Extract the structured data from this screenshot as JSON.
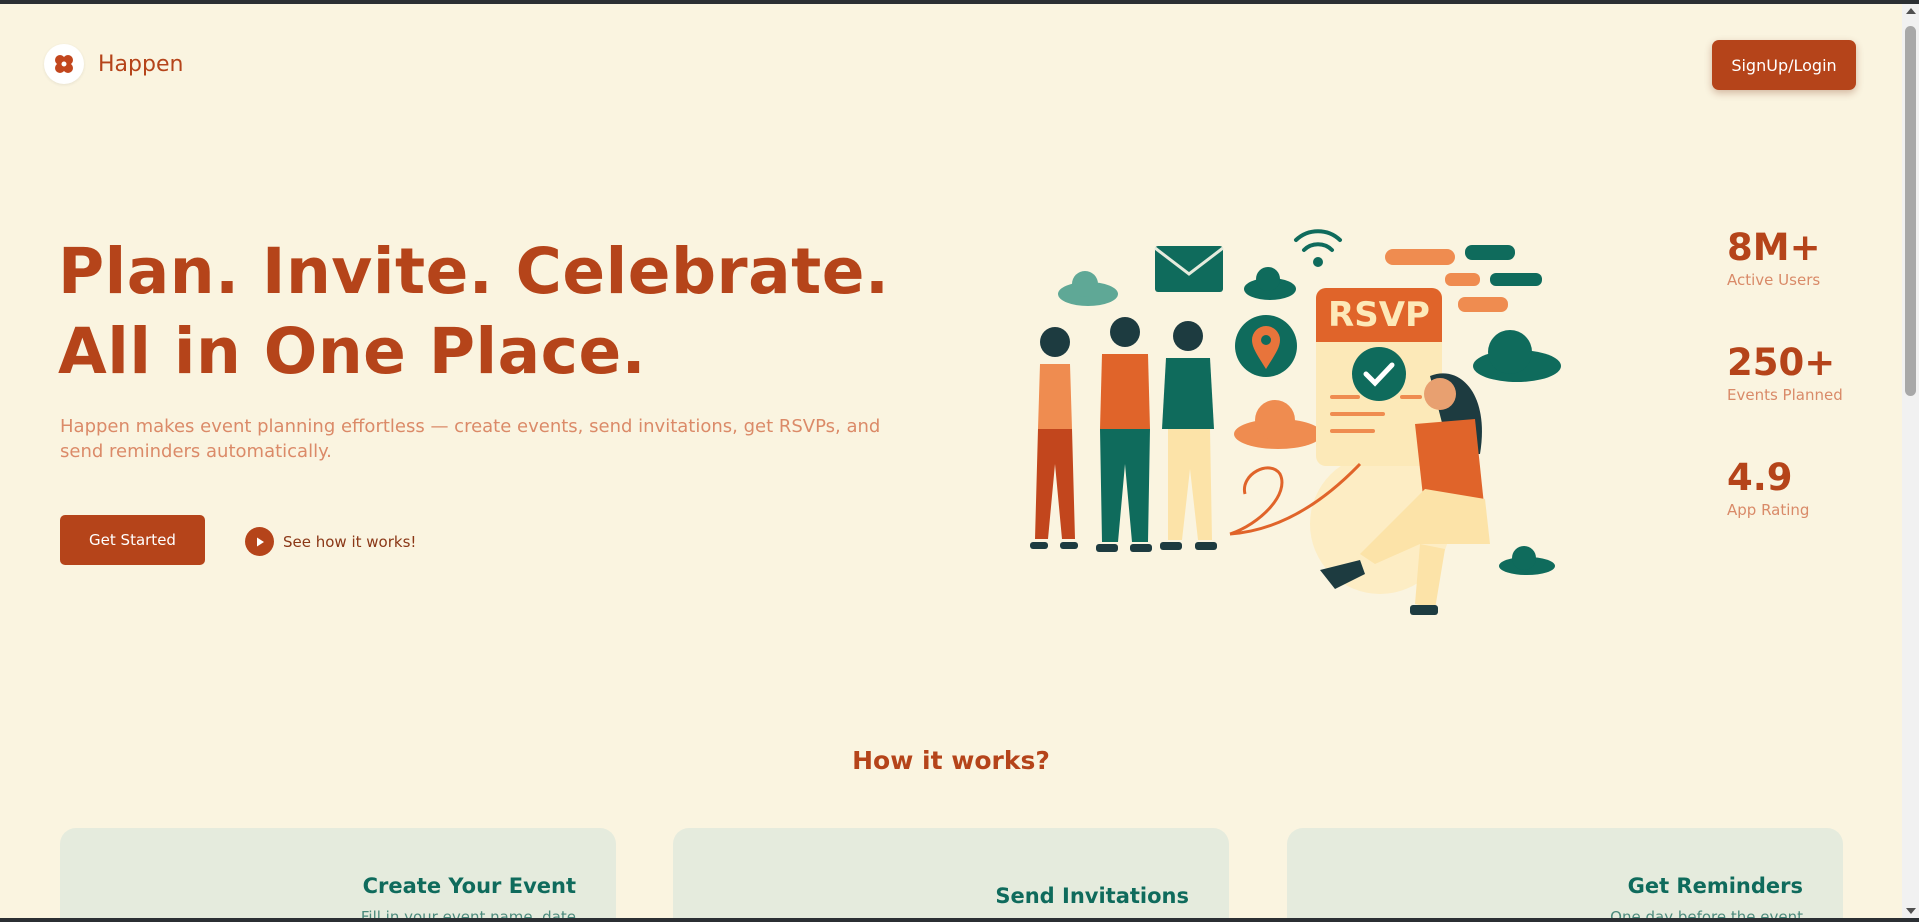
{
  "header": {
    "brand": "Happen",
    "signup_label": "SignUp/Login"
  },
  "hero": {
    "title_line1": "Plan. Invite. Celebrate.",
    "title_line2": "All in One Place.",
    "description": "Happen makes event planning effortless — create events, send invitations, get RSVPs, and send reminders automatically.",
    "cta_label": "Get Started",
    "secondary_label": "See how it works!"
  },
  "illustration": {
    "rsvp_text": "RSVP"
  },
  "stats": [
    {
      "value": "8M+",
      "label": "Active Users"
    },
    {
      "value": "250+",
      "label": "Events Planned"
    },
    {
      "value": "4.9",
      "label": "App Rating"
    }
  ],
  "how_it_works": {
    "title": "How it works?",
    "cards": [
      {
        "title": "Create Your Event",
        "desc": "Fill in your event name, date"
      },
      {
        "title": "Send Invitations",
        "desc": ""
      },
      {
        "title": "Get Reminders",
        "desc": "One day before the event"
      }
    ]
  },
  "colors": {
    "brand": "#b5441a",
    "background": "#faf4e0",
    "teal": "#0f6b5c",
    "card_bg": "#e5ebdd"
  }
}
